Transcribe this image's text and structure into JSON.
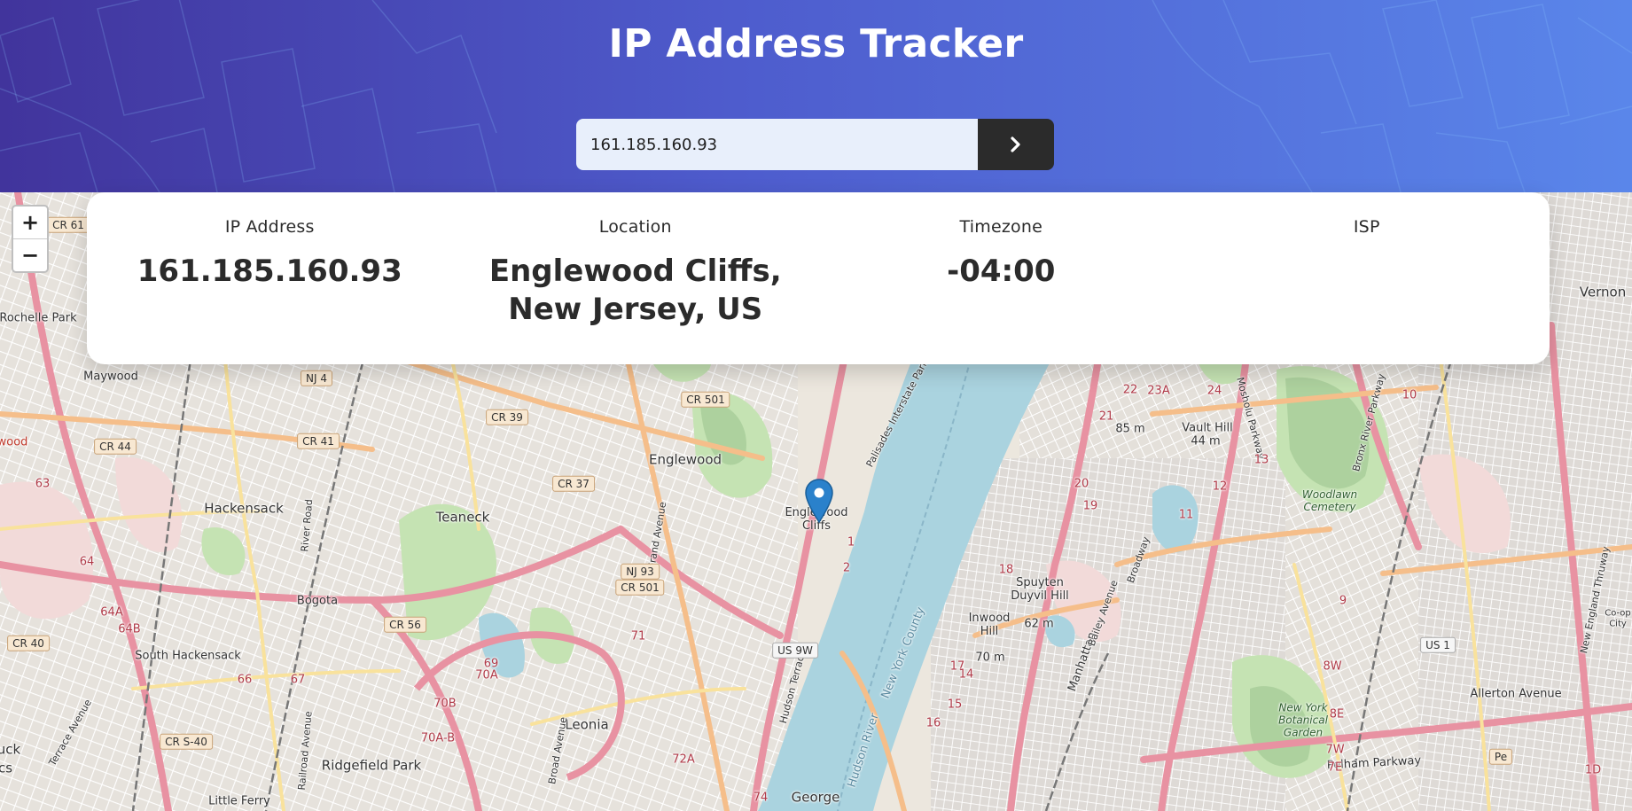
{
  "header": {
    "title": "IP Address Tracker"
  },
  "search": {
    "value": "161.185.160.93",
    "button_icon": "chevron-right-icon"
  },
  "info": {
    "ip_label": "IP Address",
    "ip_value": "161.185.160.93",
    "location_label": "Location",
    "location_value": "Englewood Cliffs, New Jersey, US",
    "timezone_label": "Timezone",
    "timezone_value": "-04:00",
    "isp_label": "ISP",
    "isp_value": ""
  },
  "map": {
    "zoom_in": "+",
    "zoom_out": "−",
    "marker_icon": "map-marker-icon",
    "places": {
      "englewood": "Englewood",
      "englewood_cliffs": "Englewood Cliffs",
      "teaneck": "Teaneck",
      "hackensack": "Hackensack",
      "south_hackensack": "South Hackensack",
      "bogota": "Bogota",
      "maywood": "Maywood",
      "rochelle_park": "Rochelle Park",
      "leonia": "Leonia",
      "ridgefield_park": "Ridgefield Park",
      "little_ferry": "Little Ferry",
      "vernon": "Vernon",
      "vault_hill": "Vault Hill",
      "vault_hill_elev": "44 m",
      "elev_85": "85 m",
      "spuyten_duyvil": "Spuyten Duyvil Hill",
      "spuyten_elev": "62 m",
      "inwood_hill": "Inwood Hill",
      "inwood_elev": "70 m",
      "woodlawn": "Woodlawn Cemetery",
      "ny_botanical": "New York Botanical Garden",
      "george": "George",
      "hudson_river": "Hudson River",
      "new_york_county": "New York County",
      "manhattan": "Manhattan",
      "allerton_avenue": "Allerton Avenue",
      "pelham_parkway": "Pelham Parkway",
      "palisades_parkway": "Palisades Interstate Parkway",
      "hudson_terrace": "Hudson Terrace",
      "grand_avenue": "Grand Avenue",
      "river_road": "River Road",
      "broadway": "Broadway",
      "mosholu_parkway": "Mosholu Parkway",
      "bronx_river_parkway": "Bronx River Parkway",
      "new_england_thruway": "New England Thruway",
      "bailey_avenue": "Bailey Avenue",
      "broad_avenue": "Broad Avenue",
      "railroad_avenue": "Railroad Avenue",
      "terrace_avenue": "Terrace Avenue",
      "uck": "uck",
      "cs": "cs",
      "wood": "wood",
      "co_op_city": "Co-op City"
    },
    "shields": {
      "cr61": "CR 61",
      "nj4": "NJ 4",
      "cr501a": "CR 501",
      "cr39": "CR 39",
      "cr41": "CR 41",
      "cr44": "CR 44",
      "cr37": "CR 37",
      "nj93": "NJ 93",
      "cr501b": "CR 501",
      "cr56": "CR 56",
      "cr40": "CR 40",
      "crs40": "CR S-40",
      "us9w": "US 9W",
      "us1": "US 1",
      "pe": "Pe",
      "n63": "63",
      "n64": "64",
      "n64a": "64A",
      "n64b": "64B",
      "n66": "66",
      "n67": "67",
      "n69": "69",
      "n70a": "70A",
      "n70b": "70B",
      "n70ab": "70A-B",
      "n71": "71",
      "n72a": "72A",
      "n74": "74",
      "n1": "1",
      "n2": "2",
      "n13": "13",
      "n16": "16",
      "n17": "17",
      "n18": "18",
      "n19": "19",
      "n20": "20",
      "n21": "21",
      "n22": "22",
      "n23a": "23A",
      "n24": "24",
      "n10": "10",
      "n9": "9",
      "n8w": "8W",
      "n8e": "8E",
      "n7w": "7W",
      "n7e": "7E",
      "n1d": "1D",
      "n11": "11",
      "n12": "12",
      "n14": "14",
      "n15": "15"
    }
  }
}
